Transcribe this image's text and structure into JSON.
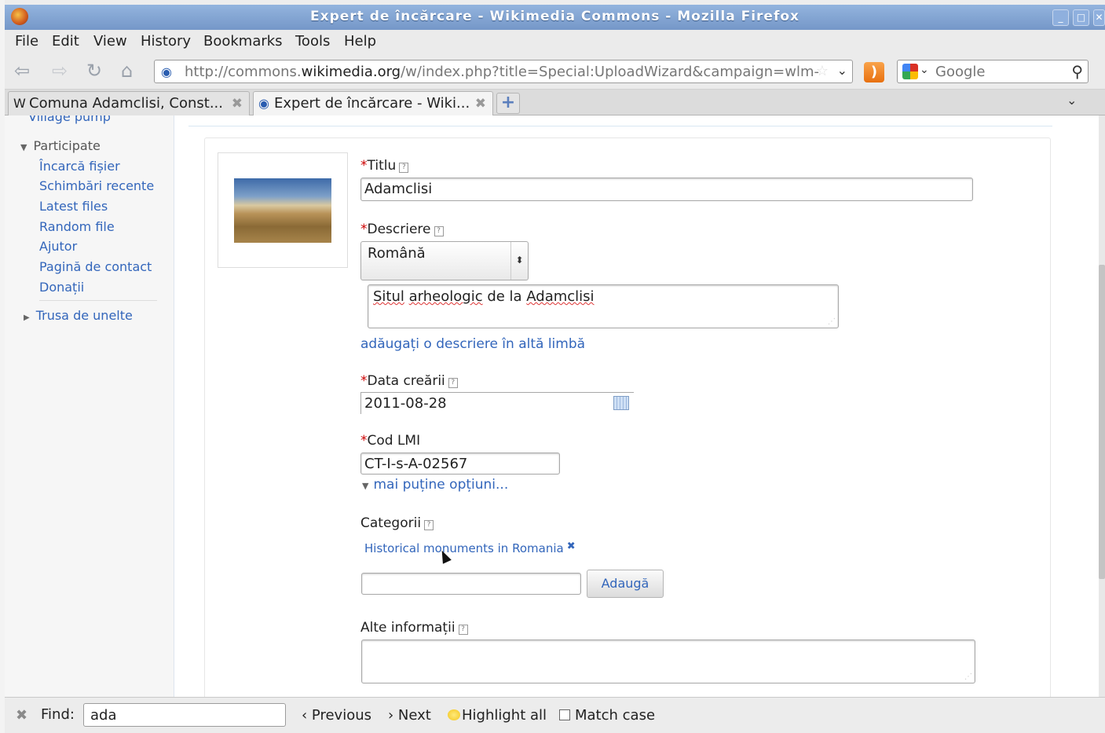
{
  "window": {
    "title": "Expert de încărcare - Wikimedia Commons - Mozilla Firefox"
  },
  "menu": [
    "File",
    "Edit",
    "View",
    "History",
    "Bookmarks",
    "Tools",
    "Help"
  ],
  "nav": {
    "url_prefix": "http://commons.",
    "url_host": "wikimedia.org",
    "url_path": "/w/index.php?title=Special:UploadWizard&campaign=wlm-r",
    "search_placeholder": "Google"
  },
  "tabs": [
    {
      "label": "Comuna Adamclisi, Const...",
      "icon": "W"
    },
    {
      "label": "Expert de încărcare - Wiki...",
      "icon": "commons"
    }
  ],
  "sidebar": {
    "cut_item": "Village pump",
    "section": "Participate",
    "items": [
      "Încarcă fișier",
      "Schimbări recente",
      "Latest files",
      "Random file",
      "Ajutor",
      "Pagină de contact",
      "Donații"
    ],
    "tools": "Trusa de unelte"
  },
  "form": {
    "title_label": "Titlu",
    "title_value": "Adamclisi",
    "desc_label": "Descriere",
    "desc_language": "Română",
    "desc_value_parts": [
      "Situl",
      " ",
      "arheologic",
      " de la ",
      "Adamclisi"
    ],
    "add_desc_link": "adăugați o descriere în altă limbă",
    "date_label": "Data creării",
    "date_value": "2011-08-28",
    "lmi_label": "Cod LMI",
    "lmi_value": "CT-I-s-A-02567",
    "fewer_options": "mai puține opțiuni...",
    "categories_label": "Categorii",
    "category": "Historical monuments in Romania",
    "add_button": "Adaugă",
    "other_info_label": "Alte informații"
  },
  "findbar": {
    "label": "Find:",
    "value": "ada",
    "previous": "Previous",
    "next": "Next",
    "highlight": "Highlight all",
    "match_case": "Match case"
  }
}
